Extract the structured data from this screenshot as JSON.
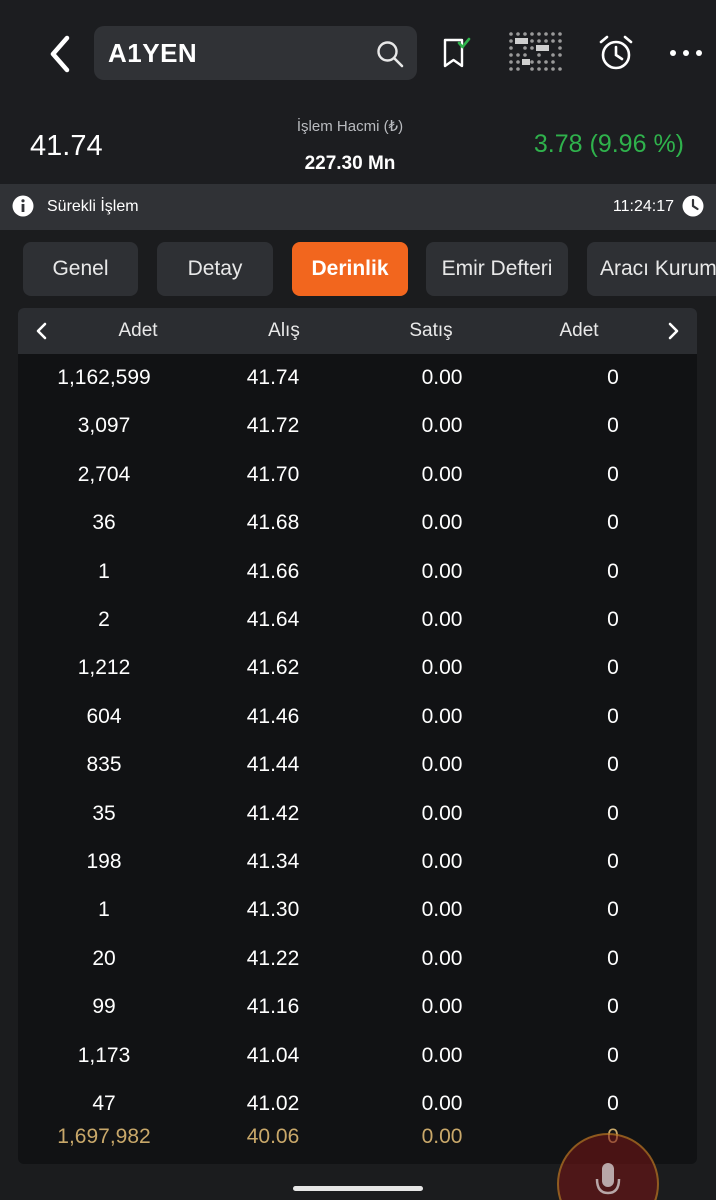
{
  "header": {
    "symbol": "A1YEN",
    "back_icon": "chevron-left-icon",
    "search_icon": "search-icon",
    "icons": [
      "bookmark-check-icon",
      "heatmap-icon",
      "alarm-icon",
      "more-icon"
    ]
  },
  "quote": {
    "last_price": "41.74",
    "volume_label": "İşlem Hacmi (₺)",
    "volume_value": "227.30 Mn",
    "change": "3.78 (9.96 %)",
    "change_color": "#2fb24c"
  },
  "status": {
    "text": "Sürekli İşlem",
    "time": "11:24:17"
  },
  "tabs": [
    {
      "label": "Genel",
      "active": false
    },
    {
      "label": "Detay",
      "active": false
    },
    {
      "label": "Derinlik",
      "active": true
    },
    {
      "label": "Emir Defteri",
      "active": false
    },
    {
      "label": "Aracı Kurum",
      "active": false
    }
  ],
  "accent_color": "#f2661e",
  "depth_table": {
    "columns": [
      "Adet",
      "Alış",
      "Satış",
      "Adet"
    ],
    "rows": [
      [
        "1,162,599",
        "41.74",
        "0.00",
        "0"
      ],
      [
        "3,097",
        "41.72",
        "0.00",
        "0"
      ],
      [
        "2,704",
        "41.70",
        "0.00",
        "0"
      ],
      [
        "36",
        "41.68",
        "0.00",
        "0"
      ],
      [
        "1",
        "41.66",
        "0.00",
        "0"
      ],
      [
        "2",
        "41.64",
        "0.00",
        "0"
      ],
      [
        "1,212",
        "41.62",
        "0.00",
        "0"
      ],
      [
        "604",
        "41.46",
        "0.00",
        "0"
      ],
      [
        "835",
        "41.44",
        "0.00",
        "0"
      ],
      [
        "35",
        "41.42",
        "0.00",
        "0"
      ],
      [
        "198",
        "41.34",
        "0.00",
        "0"
      ],
      [
        "1",
        "41.30",
        "0.00",
        "0"
      ],
      [
        "20",
        "41.22",
        "0.00",
        "0"
      ],
      [
        "99",
        "41.16",
        "0.00",
        "0"
      ],
      [
        "1,173",
        "41.04",
        "0.00",
        "0"
      ],
      [
        "47",
        "41.02",
        "0.00",
        "0"
      ]
    ],
    "total": [
      "1,697,982",
      "40.06",
      "0.00",
      "0"
    ],
    "total_color": "#c9a86a"
  }
}
